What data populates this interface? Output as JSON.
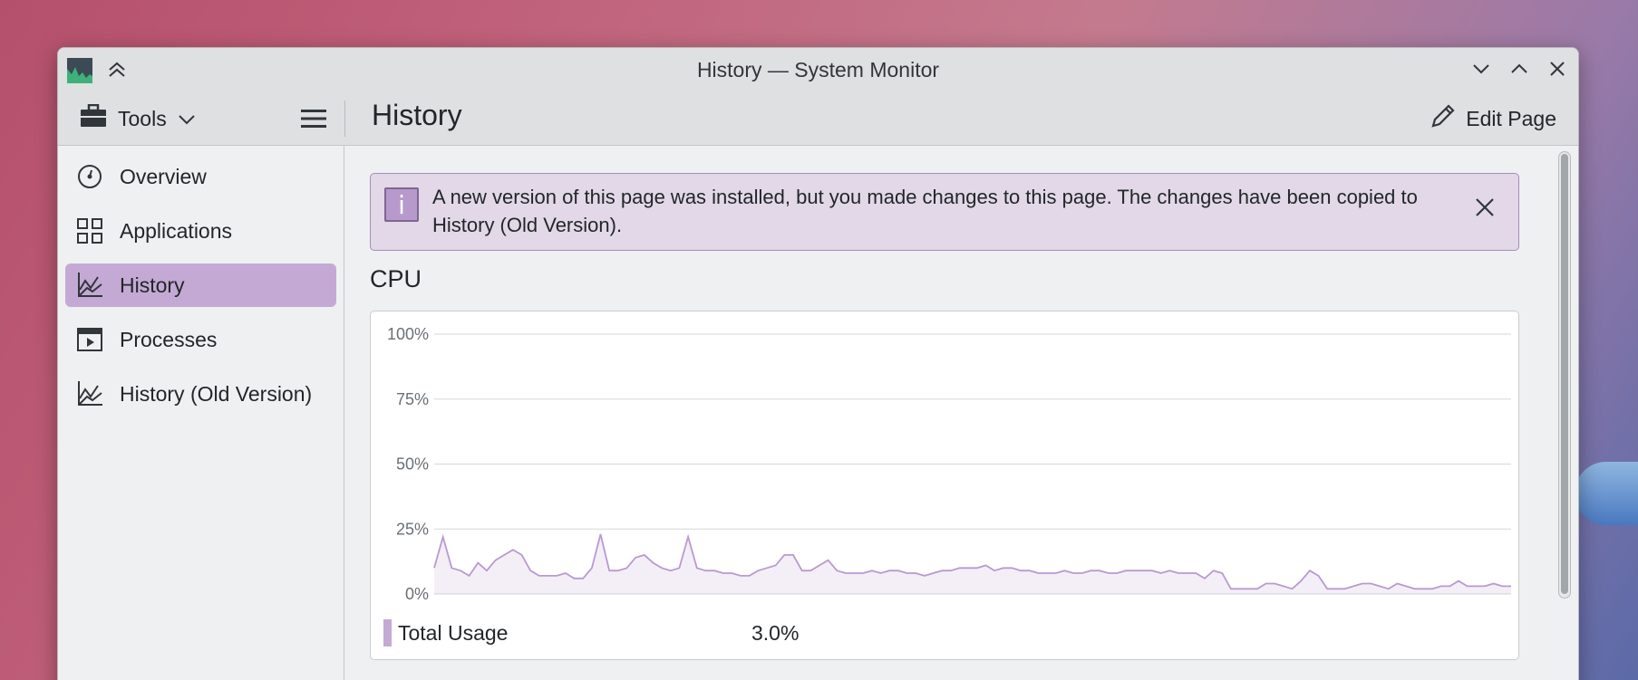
{
  "window": {
    "title": "History — System Monitor"
  },
  "toolbar": {
    "tools_label": "Tools",
    "page_title": "History",
    "edit_label": "Edit Page"
  },
  "sidebar": {
    "items": [
      {
        "label": "Overview",
        "icon": "gauge-icon",
        "active": false
      },
      {
        "label": "Applications",
        "icon": "grid-icon",
        "active": false
      },
      {
        "label": "History",
        "icon": "chart-line-icon",
        "active": true
      },
      {
        "label": "Processes",
        "icon": "window-play-icon",
        "active": false
      },
      {
        "label": "History (Old Version)",
        "icon": "chart-line-icon",
        "active": false
      }
    ]
  },
  "banner": {
    "text": "A new version of this page was installed, but you made changes to this page. The changes have been copied to History (Old Version)."
  },
  "section": {
    "title": "CPU"
  },
  "legend": {
    "label": "Total Usage",
    "value": "3.0%"
  },
  "colors": {
    "accent": "#c4a9d5",
    "series": "#b99ad0"
  },
  "chart_data": {
    "type": "area",
    "ylim": [
      0,
      100
    ],
    "y_ticks": [
      "100%",
      "75%",
      "50%",
      "25%",
      "0%"
    ],
    "grid": true,
    "series": [
      {
        "name": "Total Usage",
        "values": [
          10,
          22,
          10,
          9,
          7,
          12,
          9,
          13,
          15,
          17,
          15,
          9,
          7,
          7,
          7,
          8,
          6,
          6,
          10,
          23,
          9,
          9,
          10,
          14,
          15,
          12,
          10,
          9,
          10,
          22,
          10,
          9,
          9,
          8,
          8,
          7,
          7,
          9,
          10,
          11,
          15,
          15,
          9,
          9,
          11,
          13,
          9,
          8,
          8,
          8,
          9,
          8,
          9,
          9,
          8,
          8,
          7,
          8,
          9,
          9,
          10,
          10,
          10,
          11,
          9,
          10,
          10,
          9,
          9,
          8,
          8,
          8,
          9,
          8,
          8,
          9,
          9,
          8,
          8,
          9,
          9,
          9,
          9,
          8,
          9,
          8,
          8,
          8,
          6,
          9,
          8,
          2,
          2,
          2,
          2,
          4,
          4,
          3,
          2,
          5,
          9,
          7,
          2,
          2,
          2,
          3,
          4,
          4,
          3,
          2,
          4,
          3,
          2,
          2,
          2,
          3,
          3,
          5,
          3,
          3,
          3,
          4,
          3,
          3
        ]
      }
    ]
  }
}
